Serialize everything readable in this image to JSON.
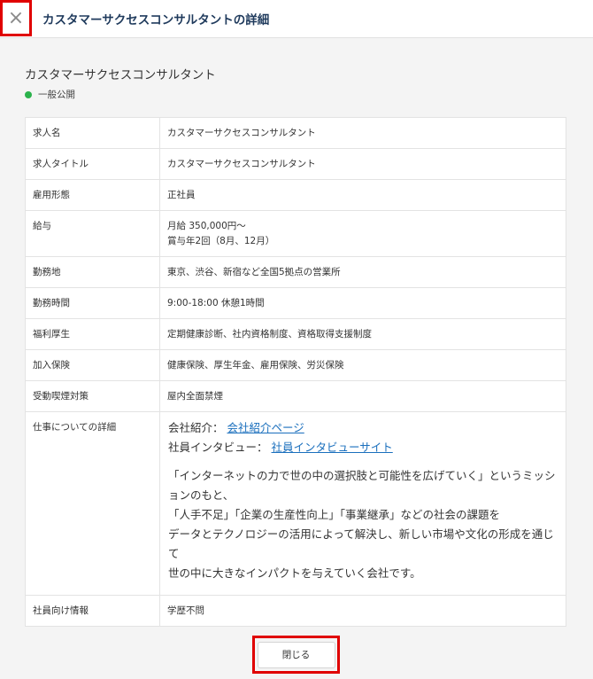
{
  "header": {
    "close_icon": "×",
    "title": "カスタマーサクセスコンサルタントの詳細"
  },
  "job": {
    "title": "カスタマーサクセスコンサルタント",
    "status": "一般公開",
    "status_color": "#2bb24c"
  },
  "details": {
    "rows": [
      {
        "label": "求人名",
        "value": "カスタマーサクセスコンサルタント"
      },
      {
        "label": "求人タイトル",
        "value": "カスタマーサクセスコンサルタント"
      },
      {
        "label": "雇用形態",
        "value": "正社員"
      },
      {
        "label": "給与",
        "value": "月給 350,000円〜",
        "value2": "賞与年2回（8月、12月）"
      },
      {
        "label": "勤務地",
        "value": "東京、渋谷、新宿など全国5拠点の営業所"
      },
      {
        "label": "勤務時間",
        "value": "9:00-18:00 休憩1時間"
      },
      {
        "label": "福利厚生",
        "value": "定期健康診断、社内資格制度、資格取得支援制度"
      },
      {
        "label": "加入保険",
        "value": "健康保険、厚生年金、雇用保険、労災保険"
      },
      {
        "label": "受動喫煙対策",
        "value": "屋内全面禁煙"
      }
    ],
    "job_detail": {
      "label": "仕事についての詳細",
      "company_prefix": "会社紹介：",
      "company_link": "会社紹介ページ",
      "interview_prefix": "社員インタビュー：",
      "interview_link": "社員インタビューサイト",
      "lines": [
        "「インターネットの力で世の中の選択肢と可能性を広げていく」というミッションのもと、",
        "「人手不足」「企業の生産性向上」「事業継承」などの社会の課題を",
        "データとテクノロジーの活用によって解決し、新しい市場や文化の形成を通じて",
        "世の中に大きなインパクトを与えていく会社です。"
      ]
    },
    "employee_info": {
      "label": "社員向け情報",
      "value": "学歴不問"
    }
  },
  "footer": {
    "close_label": "閉じる"
  }
}
